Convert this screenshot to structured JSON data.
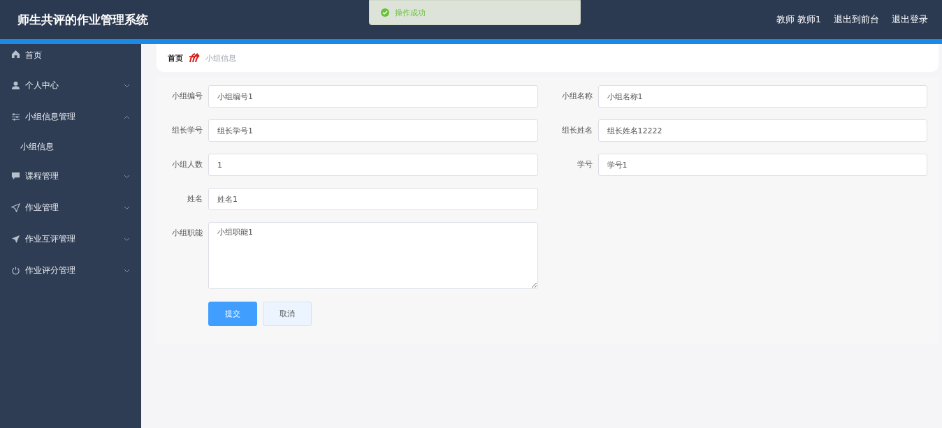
{
  "header": {
    "title": "师生共评的作业管理系统",
    "user": "教师 教师1",
    "links": [
      "退出到前台",
      "退出登录"
    ]
  },
  "toast": {
    "kind": "success",
    "message": "操作成功"
  },
  "sidebar": {
    "items": [
      {
        "label": "首页",
        "kind": "home"
      },
      {
        "label": "个人中心",
        "kind": "user",
        "expanded": false
      },
      {
        "label": "小组信息管理",
        "kind": "sliders",
        "expanded": true,
        "children": [
          {
            "label": "小组信息"
          }
        ]
      },
      {
        "label": "课程管理",
        "kind": "chat",
        "expanded": false
      },
      {
        "label": "作业管理",
        "kind": "send",
        "expanded": false
      },
      {
        "label": "作业互评管理",
        "kind": "plane",
        "expanded": false
      },
      {
        "label": "作业评分管理",
        "kind": "power",
        "expanded": false
      }
    ]
  },
  "breadcrumb": [
    "首页",
    "小组信息"
  ],
  "form": {
    "fields": [
      {
        "kind": "input",
        "label": "小组编号",
        "value": "小组编号1"
      },
      {
        "kind": "input",
        "label": "小组名称",
        "value": "小组名称1"
      },
      {
        "kind": "input",
        "label": "组长学号",
        "value": "组长学号1"
      },
      {
        "kind": "input",
        "label": "组长姓名",
        "value": "组长姓名12222"
      },
      {
        "kind": "input",
        "label": "小组人数",
        "value": "1"
      },
      {
        "kind": "input",
        "label": "学号",
        "value": "学号1"
      },
      {
        "kind": "input",
        "label": "姓名",
        "value": "姓名1"
      },
      {
        "kind": "textarea",
        "label": "小组职能",
        "value": "小组职能1"
      }
    ],
    "buttons": [
      {
        "kind": "primary",
        "label": "提交"
      },
      {
        "kind": "default",
        "label": "取消"
      }
    ]
  }
}
